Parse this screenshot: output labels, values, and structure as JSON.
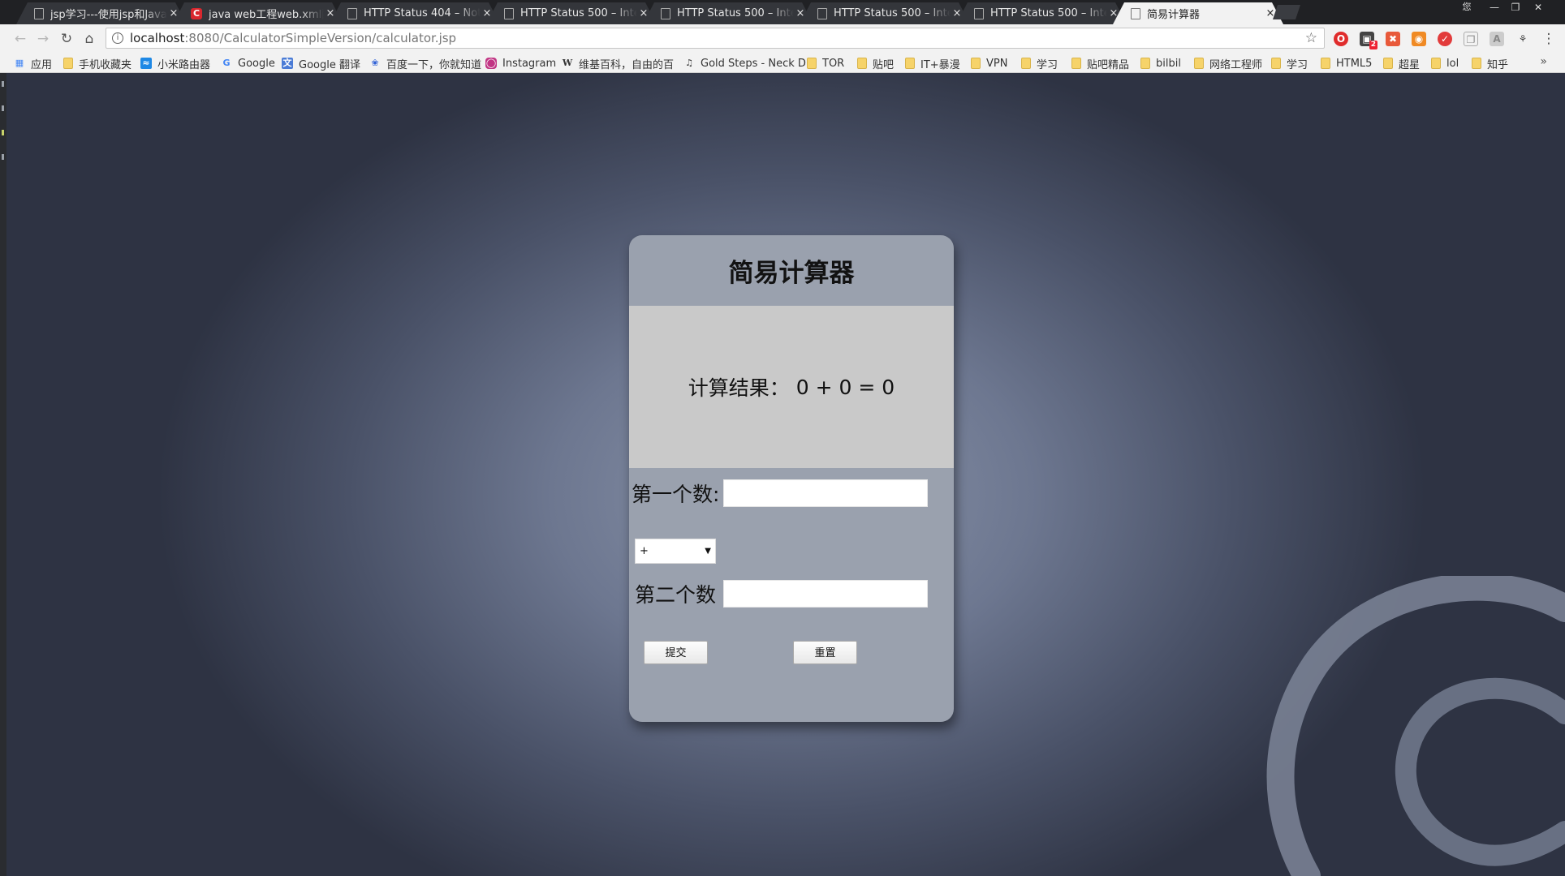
{
  "browser": {
    "tabs": [
      {
        "title": "jsp学习---使用jsp和Java"
      },
      {
        "title": "java web工程web.xml配"
      },
      {
        "title": "HTTP Status 404 – Not"
      },
      {
        "title": "HTTP Status 500 – Inter"
      },
      {
        "title": "HTTP Status 500 – Inte"
      },
      {
        "title": "HTTP Status 500 – Inte"
      },
      {
        "title": "HTTP Status 500 – Inte"
      },
      {
        "title": "简易计算器"
      }
    ],
    "active_tab": 7,
    "tab_close_glyph": "×",
    "window_user_glyph": "您",
    "address": {
      "host": "localhost",
      "path": ":8080/CalculatorSimpleVersion/calculator.jsp"
    },
    "extension_badge": "2",
    "bookmarks": [
      {
        "label": "应用",
        "icon": "apps-grid-icon"
      },
      {
        "label": "手机收藏夹",
        "icon": "folder-icon"
      },
      {
        "label": "小米路由器",
        "icon": "router-icon"
      },
      {
        "label": "Google",
        "icon": "google-icon"
      },
      {
        "label": "Google 翻译",
        "icon": "translate-icon"
      },
      {
        "label": "百度一下，你就知道",
        "icon": "baidu-paw-icon"
      },
      {
        "label": "Instagram",
        "icon": "instagram-icon"
      },
      {
        "label": "维基百科，自由的百",
        "icon": "wikipedia-icon"
      },
      {
        "label": "Gold Steps - Neck D",
        "icon": "music-note-icon"
      },
      {
        "label": "TOR",
        "icon": "folder-icon"
      },
      {
        "label": "贴吧",
        "icon": "folder-icon"
      },
      {
        "label": "IT+暴漫",
        "icon": "folder-icon"
      },
      {
        "label": "VPN",
        "icon": "folder-icon"
      },
      {
        "label": "学习",
        "icon": "folder-icon"
      },
      {
        "label": "贴吧精品",
        "icon": "folder-icon"
      },
      {
        "label": "bilbil",
        "icon": "folder-icon"
      },
      {
        "label": "网络工程师",
        "icon": "folder-icon"
      },
      {
        "label": "学习",
        "icon": "folder-icon"
      },
      {
        "label": "HTML5",
        "icon": "folder-icon"
      },
      {
        "label": "超星",
        "icon": "folder-icon"
      },
      {
        "label": "lol",
        "icon": "folder-icon"
      },
      {
        "label": "知乎",
        "icon": "folder-icon"
      }
    ],
    "bookmarks_more_glyph": "»"
  },
  "page": {
    "title": "简易计算器",
    "result_label": "计算结果：",
    "result_expression": "0 + 0 = 0",
    "first_label": "第一个数:",
    "first_value": "",
    "operator_selected": "+",
    "second_label": "第二个数",
    "second_value": "",
    "submit_label": "提交",
    "reset_label": "重置"
  },
  "colors": {
    "card_background": "#9aa1ae",
    "result_background": "#c9c9c9",
    "tab_active": "#f2f2f2",
    "tab_inactive": "#34363b"
  }
}
